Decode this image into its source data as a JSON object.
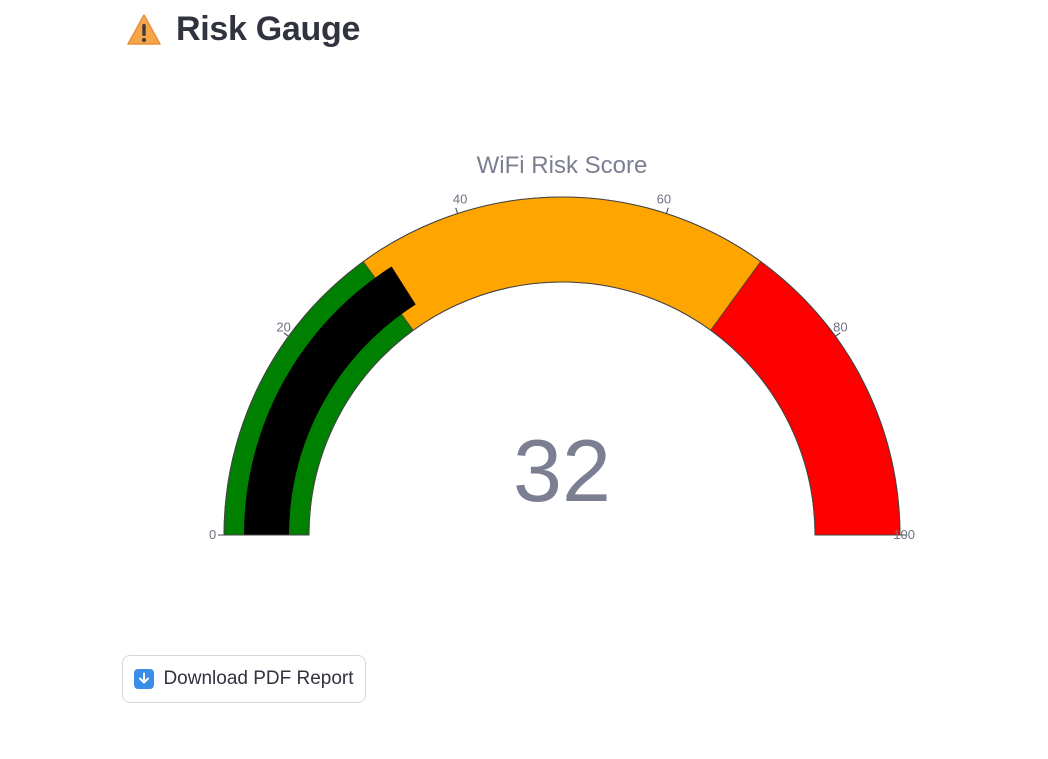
{
  "header": {
    "icon": "warning-icon",
    "title": "Risk Gauge"
  },
  "chart_data": {
    "type": "gauge",
    "title": "WiFi Risk Score",
    "value": 32,
    "range": [
      0,
      100
    ],
    "ticks": [
      0,
      20,
      40,
      60,
      80,
      100
    ],
    "tick_labels": [
      "0",
      "20",
      "40",
      "60",
      "80",
      "100"
    ],
    "steps": [
      {
        "range": [
          0,
          30
        ],
        "color": "#008000"
      },
      {
        "range": [
          30,
          70
        ],
        "color": "#ffa500"
      },
      {
        "range": [
          70,
          100
        ],
        "color": "#ff0000"
      }
    ],
    "bar_color": "#000000"
  },
  "actions": {
    "download_icon": "download-arrow-icon",
    "download_label": "Download PDF Report"
  }
}
